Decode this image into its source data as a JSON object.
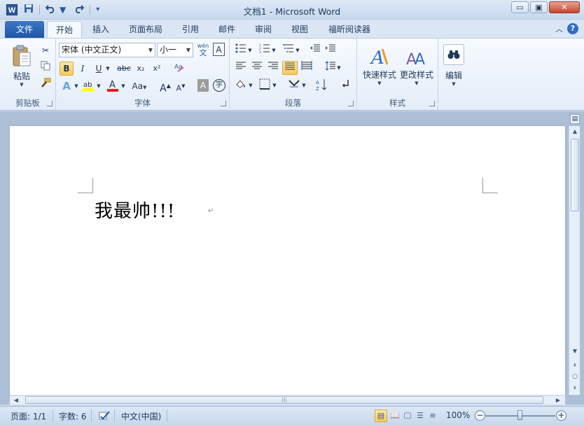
{
  "window": {
    "title": "文档1 - Microsoft Word",
    "app_icon_letter": "W",
    "min_label": "▭",
    "restore_label": "▣",
    "close_label": "✕"
  },
  "tabs": [
    {
      "label": "文件"
    },
    {
      "label": "开始"
    },
    {
      "label": "插入"
    },
    {
      "label": "页面布局"
    },
    {
      "label": "引用"
    },
    {
      "label": "邮件"
    },
    {
      "label": "审阅"
    },
    {
      "label": "视图"
    },
    {
      "label": "福昕阅读器"
    }
  ],
  "ribbon": {
    "clipboard": {
      "paste_label": "粘贴",
      "group_label": "剪贴板"
    },
    "font": {
      "font_name": "宋体 (中文正文)",
      "font_size": "小一",
      "group_label": "字体",
      "bold": "B",
      "italic": "I",
      "underline": "U",
      "strike": "abc",
      "sub": "x₂",
      "sup": "x²",
      "change_case": "Aa",
      "grow": "A",
      "shrink": "A",
      "phonetic": "wén",
      "border_char": "A",
      "char_shade": "A",
      "enclose": "字"
    },
    "paragraph": {
      "group_label": "段落"
    },
    "styles": {
      "quick_styles_label": "快速样式",
      "change_styles_label": "更改样式",
      "group_label": "样式"
    },
    "editing": {
      "label": "编辑"
    }
  },
  "document": {
    "text": "我最帅!!!",
    "para_mark": "↵"
  },
  "statusbar": {
    "page": "页面: 1/1",
    "words": "字数: 6",
    "language": "中文(中国)",
    "zoom": "100%",
    "zoom_percent": 100
  }
}
